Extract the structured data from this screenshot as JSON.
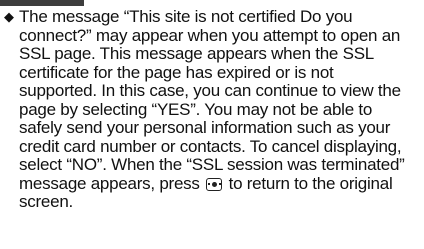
{
  "note": {
    "bullet_symbol": "◆",
    "lines": [
      "The message “This site is not certified Do you",
      "connect?” may appear when you attempt to open an",
      "SSL page. This message appears when the SSL",
      "certificate for the page has expired or is not",
      "supported. In this case, you can continue to view the",
      "page by selecting “YES”. You may not be able to",
      "safely send your personal information such as your",
      "credit card number or contacts. To cancel displaying,",
      "select “NO”. When the “SSL session was terminated”",
      "screen."
    ],
    "line_with_icon": {
      "before": "message appears, press",
      "after": "to return to the original"
    },
    "key_icon": "center-select-key-icon"
  }
}
